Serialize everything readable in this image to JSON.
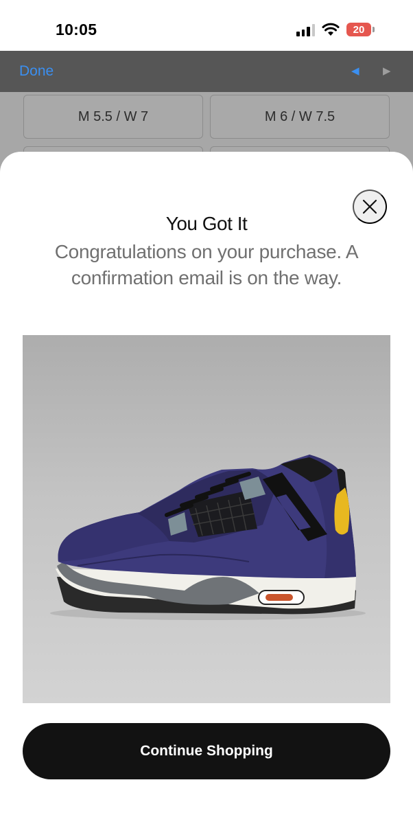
{
  "status_bar": {
    "time": "10:05",
    "battery": "20",
    "battery_color": "#e5574f"
  },
  "toolbar": {
    "done_label": "Done",
    "prev_icon": "◀",
    "next_icon": "▶",
    "accent_color": "#3b8ff0"
  },
  "sizes": [
    "M 5.5 / W 7",
    "M 6 / W 7.5"
  ],
  "modal": {
    "title": "You Got It",
    "message": "Congratulations on your purchase. A confirmation email is on the way.",
    "product_image": {
      "icon": "sneaker-image",
      "upper_color": "#3d3a7c",
      "accent_color": "#7d8f97",
      "lining_color": "#e8b820"
    },
    "cta_label": "Continue Shopping"
  }
}
